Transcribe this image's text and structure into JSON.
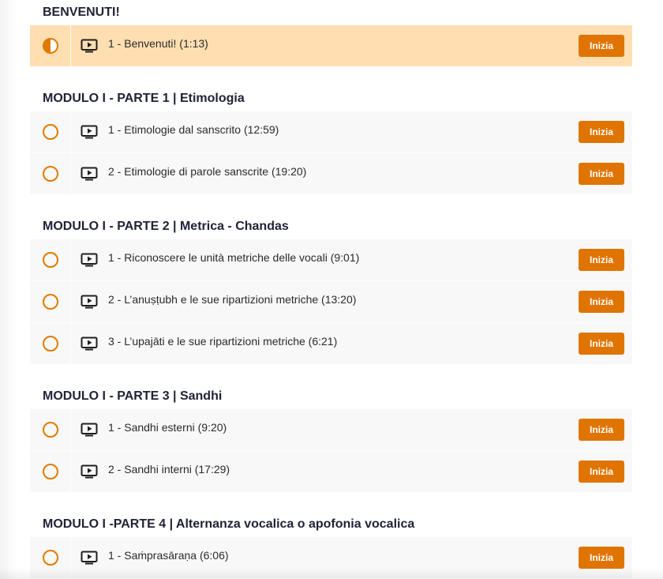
{
  "accent_color": "#e07400",
  "active_row_color": "#ffdfb1",
  "icons": {
    "status": "circle-outline-icon",
    "status_in_progress": "half-filled-circle-icon",
    "lesson_type": "video-play-icon"
  },
  "sections": [
    {
      "title": "BENVENUTI!",
      "lessons": [
        {
          "title": "1 - Benvenuti! (1:13)",
          "button": "Inizia",
          "status": "in-progress"
        }
      ]
    },
    {
      "title": "MODULO I - PARTE 1 | Etimologia",
      "lessons": [
        {
          "title": "1 - Etimologie dal sanscrito (12:59)",
          "button": "Inizia",
          "status": "not-started"
        },
        {
          "title": "2 - Etimologie di parole sanscrite (19:20)",
          "button": "Inizia",
          "status": "not-started"
        }
      ]
    },
    {
      "title": "MODULO I - PARTE 2 | Metrica - Chandas",
      "lessons": [
        {
          "title": "1 - Riconoscere le unità metriche delle vocali (9:01)",
          "button": "Inizia",
          "status": "not-started"
        },
        {
          "title": "2 - L’anuṣṭubh e le sue ripartizioni metriche (13:20)",
          "button": "Inizia",
          "status": "not-started"
        },
        {
          "title": "3 - L’upajāti e le sue ripartizioni metriche (6:21)",
          "button": "Inizia",
          "status": "not-started"
        }
      ]
    },
    {
      "title": "MODULO I - PARTE 3 | Sandhi",
      "lessons": [
        {
          "title": "1 - Sandhi esterni (9:20)",
          "button": "Inizia",
          "status": "not-started"
        },
        {
          "title": "2 - Sandhi interni (17:29)",
          "button": "Inizia",
          "status": "not-started"
        }
      ]
    },
    {
      "title": "MODULO I -PARTE 4 | Alternanza vocalica o apofonia vocalica",
      "lessons": [
        {
          "title": "1 - Saṁprasāraṇa (6:06)",
          "button": "Inizia",
          "status": "not-started"
        }
      ]
    }
  ]
}
